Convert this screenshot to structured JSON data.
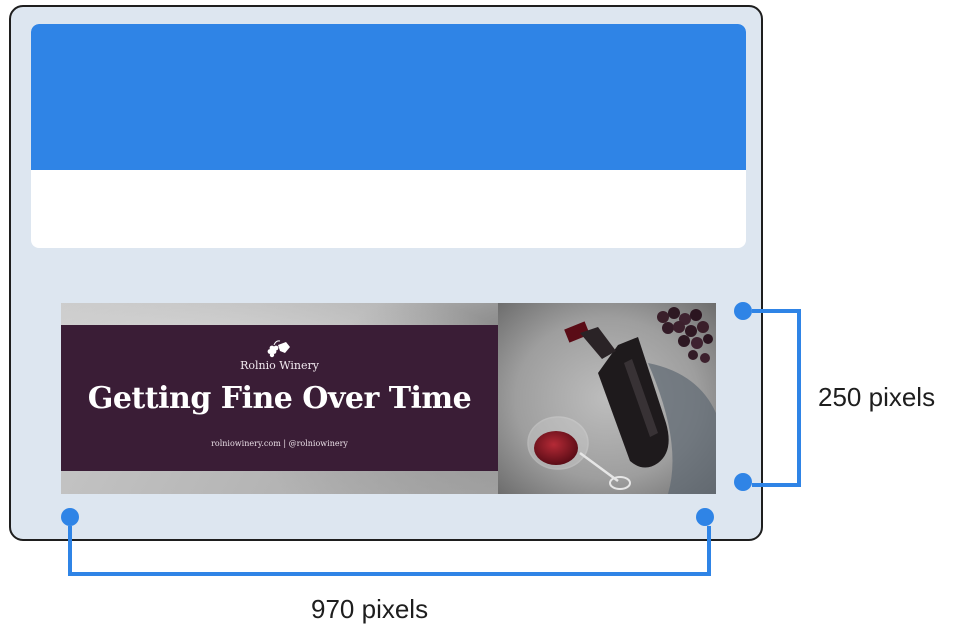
{
  "banner": {
    "brand_name": "Rolnio Winery",
    "headline": "Getting Fine Over Time",
    "contact": "rolniowinery.com  |  @rolniowinery",
    "colors": {
      "ad_background": "#3a1d36",
      "wine": "#7a1220"
    }
  },
  "dimensions": {
    "height_label": "250 pixels",
    "width_label": "970 pixels"
  },
  "colors": {
    "accent": "#2f84e6",
    "device_background": "#dde6f0",
    "device_border": "#1e1e1e"
  },
  "icons": {
    "brand": "grape-cluster-icon"
  }
}
